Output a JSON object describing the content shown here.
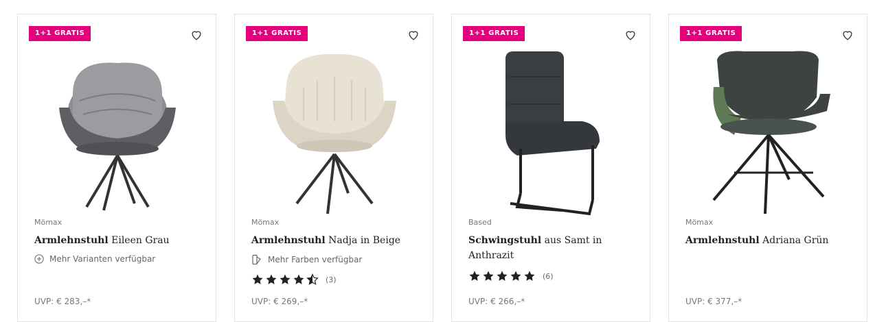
{
  "products": [
    {
      "badge": "1+1 GRATIS",
      "brand": "Mömax",
      "title_bold": "Armlehnstuhl",
      "title_rest": " Eileen Grau",
      "meta": "Mehr Varianten verfügbar",
      "rating_count": "",
      "uvp": "UVP: € 283,–*"
    },
    {
      "badge": "1+1 GRATIS",
      "brand": "Mömax",
      "title_bold": "Armlehnstuhl",
      "title_rest": " Nadja in Beige",
      "meta": "Mehr Farben verfügbar",
      "rating": 4.5,
      "rating_count": "(3)",
      "uvp": "UVP: € 269,–*"
    },
    {
      "badge": "1+1 GRATIS",
      "brand": "Based",
      "title_bold": "Schwingstuhl",
      "title_rest": " aus Samt in Anthrazit",
      "meta": "",
      "rating": 5,
      "rating_count": "(6)",
      "uvp": "UVP: € 266,–*"
    },
    {
      "badge": "1+1 GRATIS",
      "brand": "Mömax",
      "title_bold": "Armlehnstuhl",
      "title_rest": " Adriana Grün",
      "meta": "",
      "rating_count": "",
      "uvp": "UVP: € 377,–*"
    }
  ],
  "colors": {
    "badge": "#e5007d",
    "star": "#222222"
  },
  "icons": [
    "heart-icon",
    "plus-circle-icon",
    "color-swatch-icon",
    "star-icon"
  ]
}
